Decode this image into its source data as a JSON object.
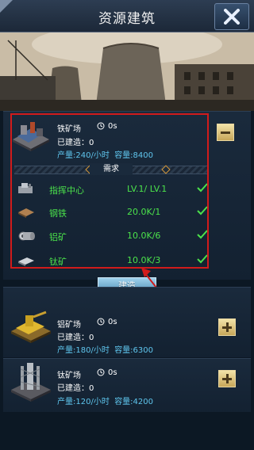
{
  "header": {
    "title": "资源建筑",
    "close_icon": "close-x-icon"
  },
  "colors": {
    "accent_green": "#4be24b",
    "rate_blue": "#5fc6ee",
    "highlight_red": "#d11b1b",
    "build_button": "#7ab6d8"
  },
  "buildings": [
    {
      "name": "铁矿场",
      "time": "0s",
      "built": "已建造：0",
      "rate": "产量:240/小时",
      "capacity": "容量:8400",
      "expanded": true,
      "toggle_icon": "minus-icon"
    },
    {
      "name": "铝矿场",
      "time": "0s",
      "built": "已建造：0",
      "rate": "产量:180/小时",
      "capacity": "容量:6300",
      "expanded": false,
      "toggle_icon": "plus-icon"
    },
    {
      "name": "钛矿场",
      "time": "0s",
      "built": "已建造：0",
      "rate": "产量:120/小时",
      "capacity": "容量:4200",
      "expanded": false,
      "toggle_icon": "plus-icon"
    }
  ],
  "requirements": {
    "title": "需求",
    "items": [
      {
        "name": "指挥中心",
        "value": "LV.1/ LV.1",
        "icon": "command-center-icon"
      },
      {
        "name": "钢铁",
        "value": "20.0K/1",
        "icon": "steel-icon"
      },
      {
        "name": "铝矿",
        "value": "10.0K/6",
        "icon": "aluminum-icon"
      },
      {
        "name": "钛矿",
        "value": "10.0K/3",
        "icon": "titanium-icon"
      }
    ]
  },
  "build_button": {
    "label": "建造"
  }
}
